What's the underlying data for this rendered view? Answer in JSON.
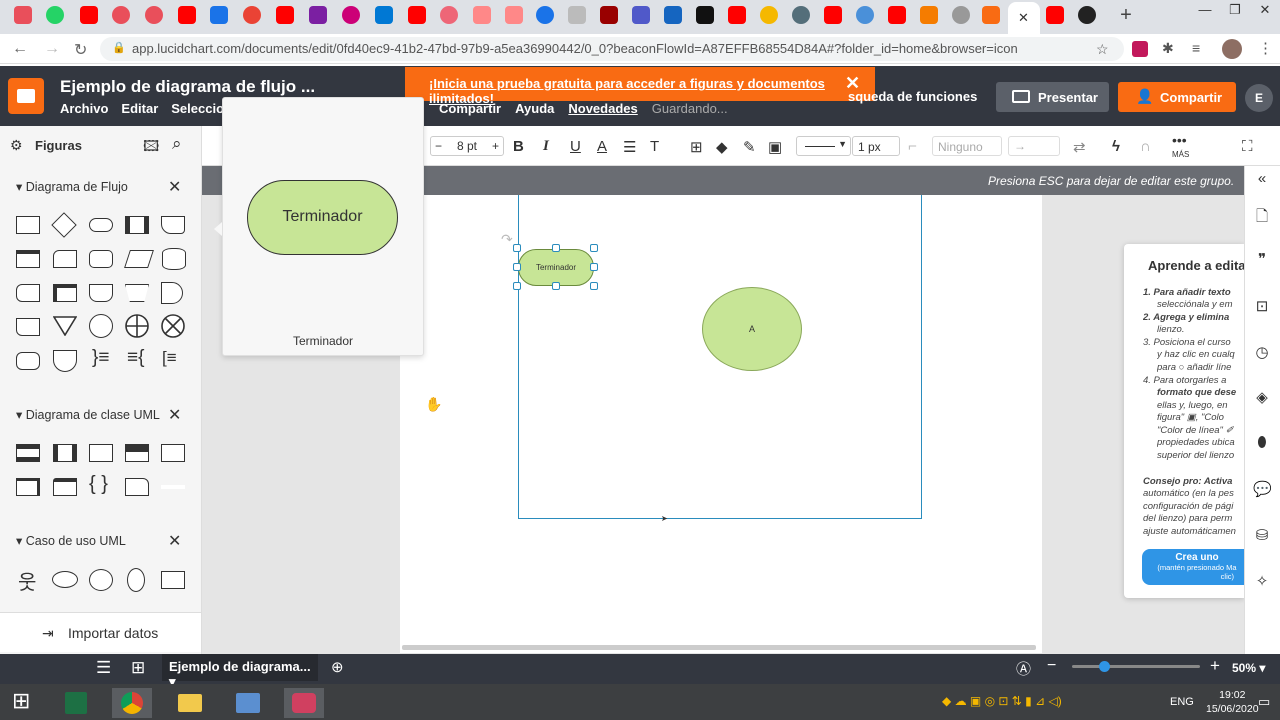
{
  "browser": {
    "url": "app.lucidchart.com/documents/edit/0fd40ec9-41b2-47bd-97b9-a5ea36990442/0_0?beaconFlowId=A87EFFB68554D84A#?folder_id=home&browser=icon",
    "close_tab": "✕",
    "new_tab": "+"
  },
  "app": {
    "doc_title": "Ejemplo de diagrama de flujo ...",
    "menus_left": [
      "Archivo",
      "Editar",
      "Selecciona"
    ],
    "menus_right": [
      "Compartir",
      "Ayuda",
      "Novedades"
    ],
    "saving": "Guardando...",
    "promo": "¡Inicia una prueba gratuita para acceder a figuras y documentos ilimitados!",
    "feature_search": "squeda de funciones",
    "present": "Presentar",
    "share": "Compartir",
    "avatar": "E"
  },
  "left_panel": {
    "title": "Figuras",
    "sections": [
      "Diagrama de Flujo",
      "Diagrama de clase UML",
      "Caso de uso UML"
    ],
    "import": "Importar datos"
  },
  "toolbar": {
    "font_size": "8 pt",
    "minus": "−",
    "plus": "+",
    "bold": "B",
    "italic": "I",
    "underline": "U",
    "font_color": "A",
    "line_width": "1 px",
    "arrow_start": "Ninguno",
    "more": "MÁS"
  },
  "canvas": {
    "group_message": "Presiona ESC para dejar de editar este grupo.",
    "terminator_label": "Terminador",
    "ellipse_label": "A"
  },
  "popover": {
    "shape_label": "Terminador",
    "caption": "Terminador"
  },
  "help": {
    "title": "Aprende a editar",
    "lines": [
      "1. Para añadir texto",
      "selecciónala y em",
      "2. Agrega y elimina",
      "lienzo.",
      "3. Posiciona el curso",
      "y haz clic en cualq",
      "para ○ añadir líne",
      "4. Para otorgarles a",
      "formato que dese",
      "ellas y, luego, en",
      "figura\" ▣, \"Colo",
      "\"Color de línea\" ✐",
      "propiedades ubica",
      "superior del lienzo",
      "Consejo pro: Activa",
      "automático (en la pes",
      "configuración de pági",
      "del lienzo) para perm",
      "ajuste automáticamen"
    ],
    "create_btn": "Crea uno",
    "create_sub": "(mantén presionado Ma",
    "create_sub2": "clic)"
  },
  "bottom": {
    "page_tab": "Ejemplo de diagrama...",
    "zoom": "50%",
    "zoom_level": 0.25
  },
  "taskbar": {
    "lang": "ENG",
    "time": "19:02",
    "date": "15/06/2020"
  },
  "colors": {
    "brand": "#f96b13",
    "header": "#333740",
    "shape_fill": "#c7e596",
    "selection": "#2a8cbd"
  }
}
